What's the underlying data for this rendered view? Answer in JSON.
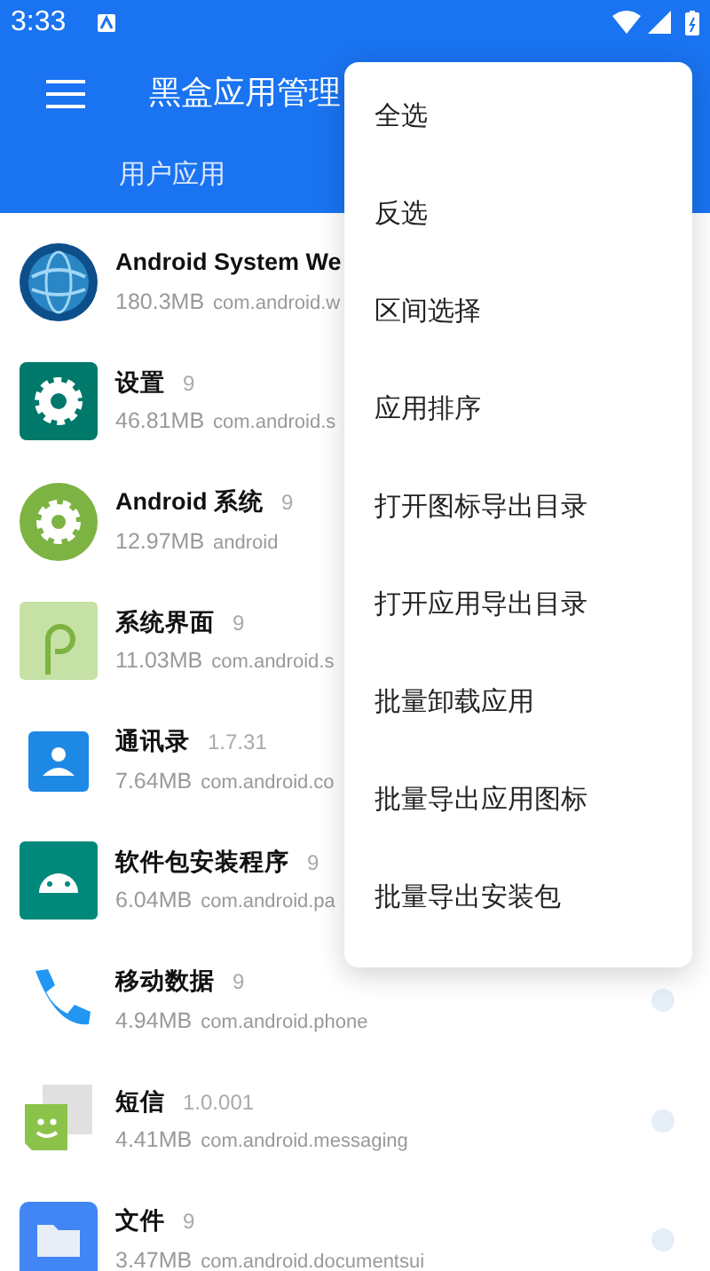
{
  "status_bar": {
    "time": "3:33"
  },
  "toolbar": {
    "title": "黑盒应用管理"
  },
  "tabs": [
    {
      "label": "用户应用"
    }
  ],
  "apps": [
    {
      "kind": "globe",
      "name": "Android System We",
      "size": "180.3MB",
      "package": "com.android.w"
    },
    {
      "kind": "settings",
      "name": "设置",
      "version": "9",
      "size": "46.81MB",
      "package": "com.android.s"
    },
    {
      "kind": "android-settings",
      "name": "Android 系统",
      "version": "9",
      "size": "12.97MB",
      "package": "android"
    },
    {
      "kind": "p-logo",
      "name": "系统界面",
      "version": "9",
      "size": "11.03MB",
      "package": "com.android.s"
    },
    {
      "kind": "contacts",
      "name": "通讯录",
      "version": "1.7.31",
      "size": "7.64MB",
      "package": "com.android.co"
    },
    {
      "kind": "installer",
      "name": "软件包安装程序",
      "version": "9",
      "size": "6.04MB",
      "package": "com.android.pa"
    },
    {
      "kind": "phone",
      "name": "移动数据",
      "version": "9",
      "size": "4.94MB",
      "package": "com.android.phone",
      "checked": false
    },
    {
      "kind": "messaging",
      "name": "短信",
      "version": "1.0.001",
      "size": "4.41MB",
      "package": "com.android.messaging",
      "checked": false
    },
    {
      "kind": "files",
      "name": "文件",
      "version": "9",
      "size": "3.47MB",
      "package": "com.android.documentsui",
      "checked": false
    }
  ],
  "menu": [
    "全选",
    "反选",
    "区间选择",
    "应用排序",
    "打开图标导出目录",
    "打开应用导出目录",
    "批量卸载应用",
    "批量导出应用图标",
    "批量导出安装包"
  ]
}
